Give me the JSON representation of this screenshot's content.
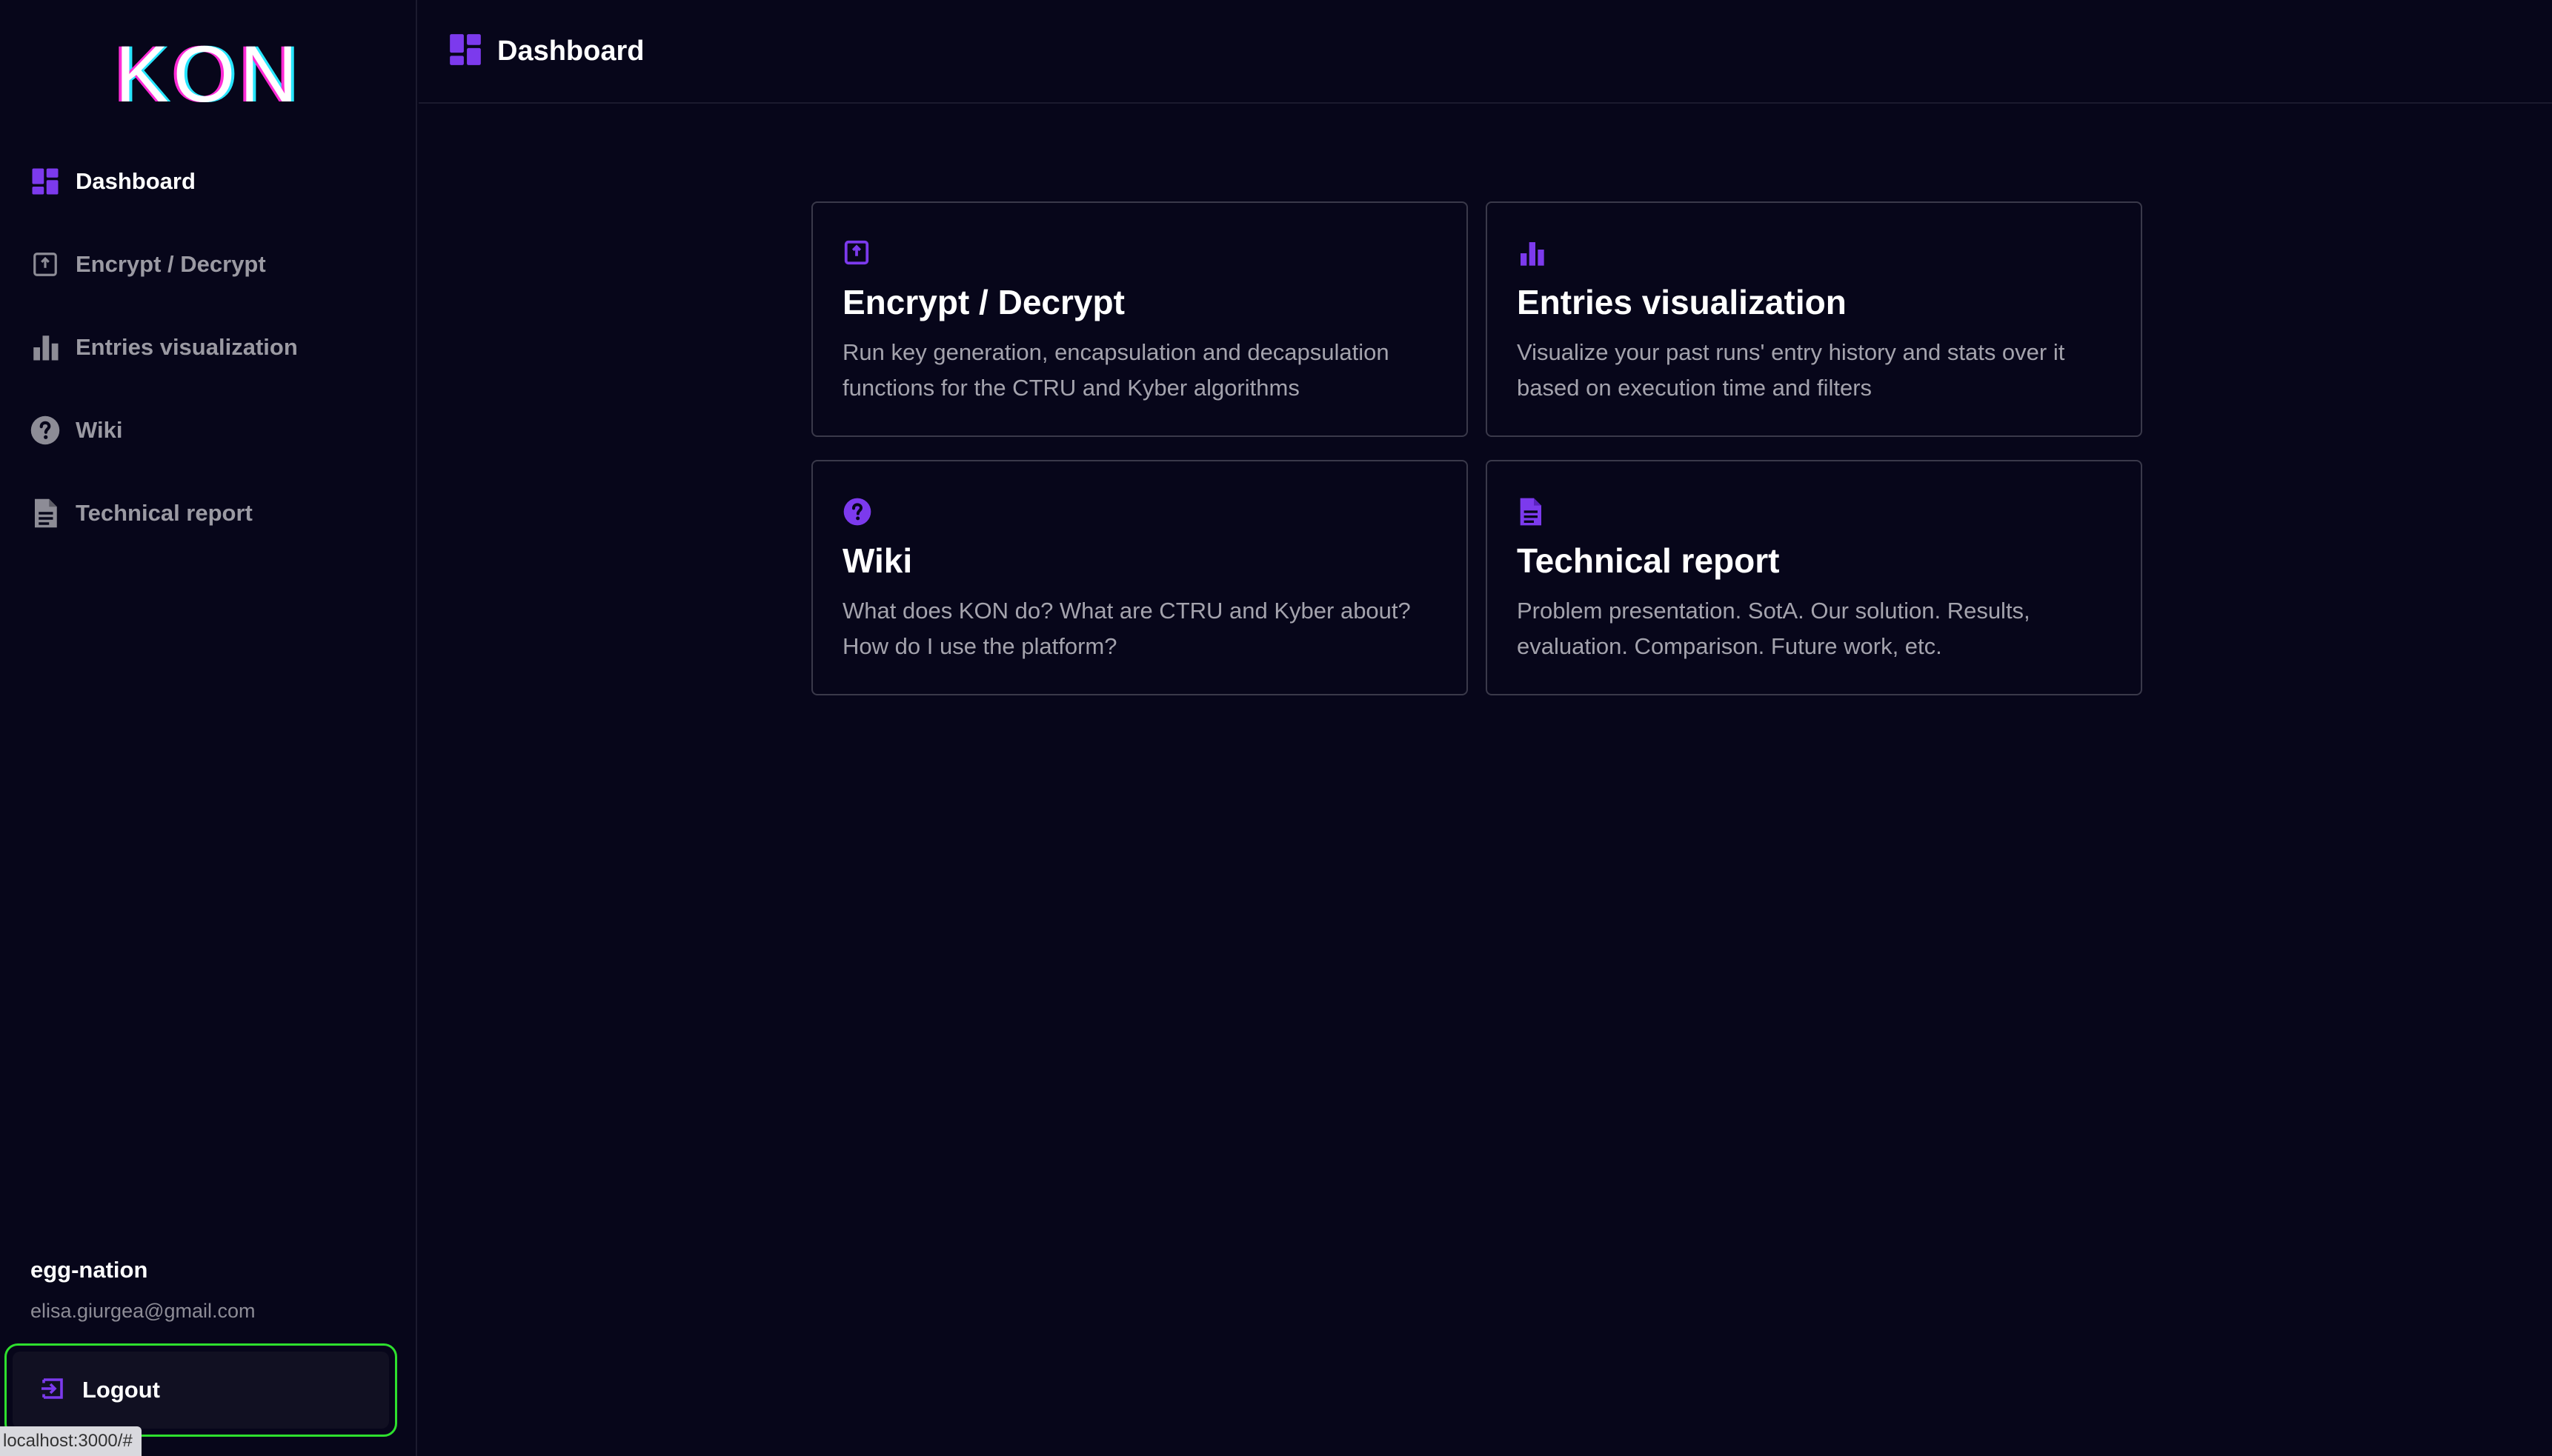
{
  "app": {
    "logo": "KON"
  },
  "sidebar": {
    "items": [
      {
        "label": "Dashboard",
        "icon": "dashboard-icon",
        "active": true
      },
      {
        "label": "Encrypt / Decrypt",
        "icon": "encrypt-icon",
        "active": false
      },
      {
        "label": "Entries visualization",
        "icon": "bar-chart-icon",
        "active": false
      },
      {
        "label": "Wiki",
        "icon": "help-circle-icon",
        "active": false
      },
      {
        "label": "Technical report",
        "icon": "document-icon",
        "active": false
      }
    ],
    "user": {
      "name": "egg-nation",
      "email": "elisa.giurgea@gmail.com"
    },
    "logout_label": "Logout"
  },
  "header": {
    "title": "Dashboard",
    "icon": "dashboard-icon"
  },
  "cards": [
    {
      "title": "Encrypt / Decrypt",
      "description": "Run key generation, encapsulation and decapsulation functions for the CTRU and Kyber algorithms",
      "icon": "encrypt-icon"
    },
    {
      "title": "Entries visualization",
      "description": "Visualize your past runs' entry history and stats over it based on execution time and filters",
      "icon": "bar-chart-icon"
    },
    {
      "title": "Wiki",
      "description": "What does KON do? What are CTRU and Kyber about? How do I use the platform?",
      "icon": "help-circle-icon"
    },
    {
      "title": "Technical report",
      "description": "Problem presentation. SotA. Our solution. Results, evaluation. Comparison. Future work, etc.",
      "icon": "document-icon"
    }
  ],
  "status_bar": {
    "url": "localhost:3000/#"
  },
  "colors": {
    "accent": "#7c3aed",
    "background": "#07061a",
    "highlight": "#2ee02e"
  }
}
